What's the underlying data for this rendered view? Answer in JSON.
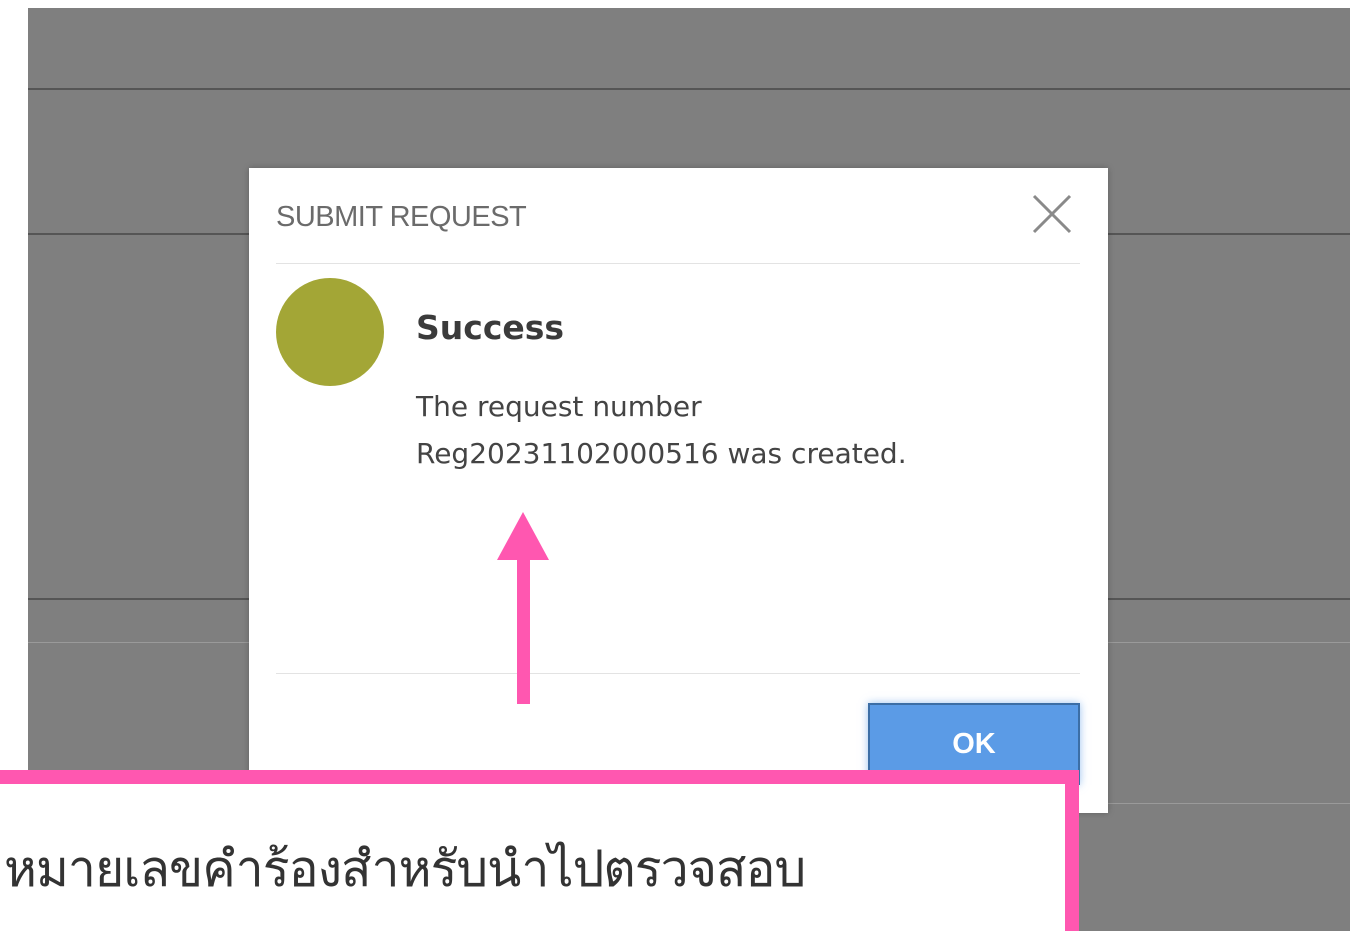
{
  "dialog": {
    "title": "SUBMIT REQUEST",
    "status_title": "Success",
    "message_line1": "The request number",
    "message_line2": "Reg20231102000516 was created.",
    "ok_label": "OK",
    "status_color": "#a3a636",
    "ok_color": "#5b9be6"
  },
  "annotation": {
    "text": "หมายเลขคำร้องสำหรับนำไปตรวจสอบ",
    "accent_color": "#ff57b0",
    "arrow_icon": "arrow-up-icon"
  }
}
